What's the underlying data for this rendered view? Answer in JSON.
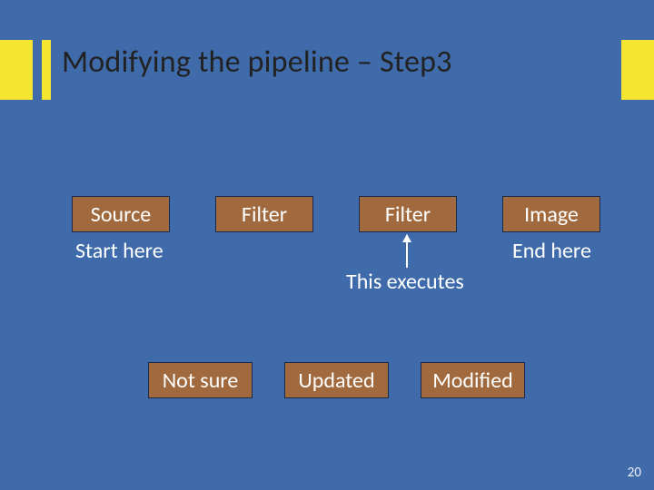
{
  "slide": {
    "title": "Modifying the pipeline – Step3",
    "page_number": "20"
  },
  "pipeline": {
    "nodes": {
      "source": "Source",
      "filter1": "Filter",
      "filter2": "Filter",
      "image": "Image"
    },
    "labels": {
      "start": "Start here",
      "end": "End here",
      "executes": "This executes"
    },
    "status": {
      "notsure": "Not sure",
      "updated": "Updated",
      "modified": "Modified"
    }
  }
}
